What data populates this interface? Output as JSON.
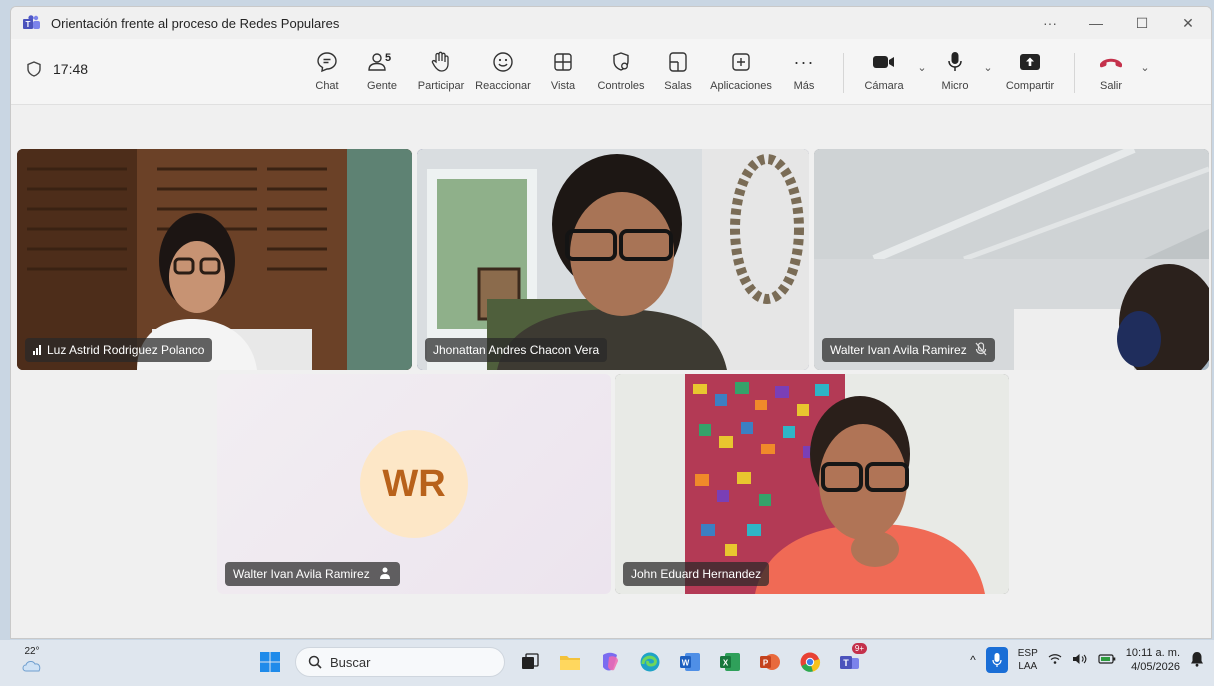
{
  "window": {
    "title": "Orientación frente al proceso de Redes Populares"
  },
  "toolbar": {
    "timer": "17:48",
    "people_count": "5",
    "items": [
      {
        "label": "Chat"
      },
      {
        "label": "Gente"
      },
      {
        "label": "Participar"
      },
      {
        "label": "Reaccionar"
      },
      {
        "label": "Vista"
      },
      {
        "label": "Controles"
      },
      {
        "label": "Salas"
      },
      {
        "label": "Aplicaciones"
      },
      {
        "label": "Más"
      }
    ],
    "camera": "Cámara",
    "mic": "Micro",
    "share": "Compartir",
    "leave": "Salir"
  },
  "participants": [
    {
      "name": "Luz Astrid Rodriguez Polanco"
    },
    {
      "name": "Jhonattan Andres Chacon Vera"
    },
    {
      "name": "Walter Ivan Avila Ramirez"
    },
    {
      "name": "Walter Ivan Avila Ramirez",
      "initials": "WR"
    },
    {
      "name": "John Eduard Hernandez"
    }
  ],
  "taskbar": {
    "temperature": "22°",
    "search_placeholder": "Buscar",
    "lang_1": "ESP",
    "lang_2": "LAA",
    "time": "10:11 a. m.",
    "date": "4/05/2026",
    "notif_badge": "9+"
  },
  "colors": {
    "accent": "#6264a7",
    "leave": "#c4314b"
  }
}
